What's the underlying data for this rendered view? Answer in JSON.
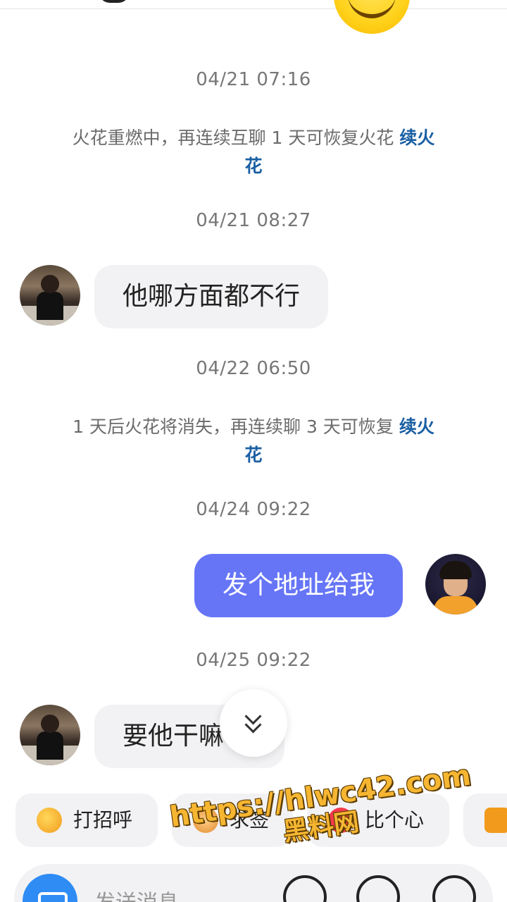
{
  "timestamps": {
    "t1": "04/21 07:16",
    "t2": "04/21 08:27",
    "t3": "04/22 06:50",
    "t4": "04/24 09:22",
    "t5": "04/25 09:22"
  },
  "system_messages": {
    "m1": {
      "text": "火花重燃中，再连续互聊 1 天可恢复火花",
      "link": "续火花"
    },
    "m2": {
      "text": "1 天后火花将消失，再连续聊 3 天可恢复",
      "link": "续火花"
    }
  },
  "messages": {
    "in1": "他哪方面都不行",
    "out1": "发个地址给我",
    "in2": "要他干嘛"
  },
  "quick_chips": {
    "greet": "打招呼",
    "ask": "求签",
    "heart": "比个心"
  },
  "watermark": {
    "line1": "https://hlwc42.com",
    "line2": "黑料网"
  },
  "input": {
    "placeholder": "发送消息"
  },
  "colors": {
    "outgoing_bubble": "#6675f6",
    "incoming_bubble": "#f2f2f4",
    "link": "#1a5fa3",
    "camera_button": "#2f8cf5"
  }
}
